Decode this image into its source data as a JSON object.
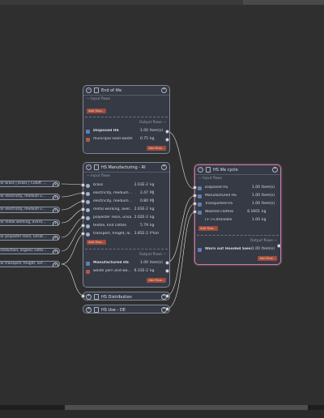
{
  "nodes": {
    "end_of_life": {
      "title": "End of life",
      "input_flows_label": "Input flows",
      "add_flow_in": "Add flow...",
      "output_flows_label": "Output flows",
      "outputs": [
        {
          "name": "Disposed HS",
          "amount": "1.00",
          "unit": "Item(s)",
          "bold": true
        },
        {
          "name": "municipal solid waste",
          "amount": "0.75",
          "unit": "kg"
        }
      ],
      "add_flow_out": "Add flow..."
    },
    "manufacturing": {
      "title": "HS Manufacturing - RI",
      "input_flows_label": "Input flows",
      "inputs": [
        {
          "name": "brass",
          "amount": "2.03E-2",
          "unit": "kg"
        },
        {
          "name": "electricity, medium ...",
          "amount": "2.47",
          "unit": "MJ"
        },
        {
          "name": "electricity, medium ...",
          "amount": "0.80",
          "unit": "MJ"
        },
        {
          "name": "metal working, aver...",
          "amount": "2.03E-2",
          "unit": "kg"
        },
        {
          "name": "polyester resin, unsa...",
          "amount": "2.02E-2",
          "unit": "kg"
        },
        {
          "name": "textile, knit cotton",
          "amount": "5.79",
          "unit": "kg"
        },
        {
          "name": "transport, freight, lo...",
          "amount": "3.85E-2",
          "unit": "t*km"
        }
      ],
      "add_flow_in": "Add flow...",
      "output_flows_label": "Output flows",
      "outputs": [
        {
          "name": "Manufactured HS",
          "amount": "1.00",
          "unit": "Item(s)",
          "bold": true
        },
        {
          "name": "waste yarn and wa...",
          "amount": "6.33E-2",
          "unit": "kg"
        }
      ],
      "add_flow_out": "Add flow..."
    },
    "distribution": {
      "title": "HS Distribution"
    },
    "use": {
      "title": "HS Use - DE"
    },
    "life_cycle": {
      "title": "HS life cycle",
      "input_flows_label": "Input flows",
      "inputs": [
        {
          "name": "Disposed HS",
          "amount": "1.00",
          "unit": "Item(s)"
        },
        {
          "name": "Manufactured HS",
          "amount": "1.00",
          "unit": "Item(s)"
        },
        {
          "name": "Transported HS",
          "amount": "1.00",
          "unit": "Item(s)"
        },
        {
          "name": "Washed clothes",
          "amount": "6.1601",
          "unit": "kg"
        },
        {
          "name": "(+-)-Citronellol",
          "amount": "1.00",
          "unit": "kg"
        }
      ],
      "add_flow_in": "Add flow...",
      "output_flows_label": "Output flows",
      "outputs": [
        {
          "name": "Worn out Hooded Swea...",
          "amount": "1.00",
          "unit": "Item(s)",
          "bold": true
        }
      ],
      "add_flow_out": "Add flow..."
    }
  },
  "providers": [
    " for brass | brass | Cutoff, ...",
    "for electricity, medium v...",
    "for electricity, medium v...",
    "for metal working, avera...",
    "for polyester resin, unsat...",
    "production, organic cotto...",
    " for transport, freight, lorr..."
  ],
  "colors": {
    "canvas": "#2f2f2f",
    "node_bg": "#353a45",
    "node_border": "#7d8596",
    "selected": "#c77aa3",
    "button": "#a24a3a"
  }
}
